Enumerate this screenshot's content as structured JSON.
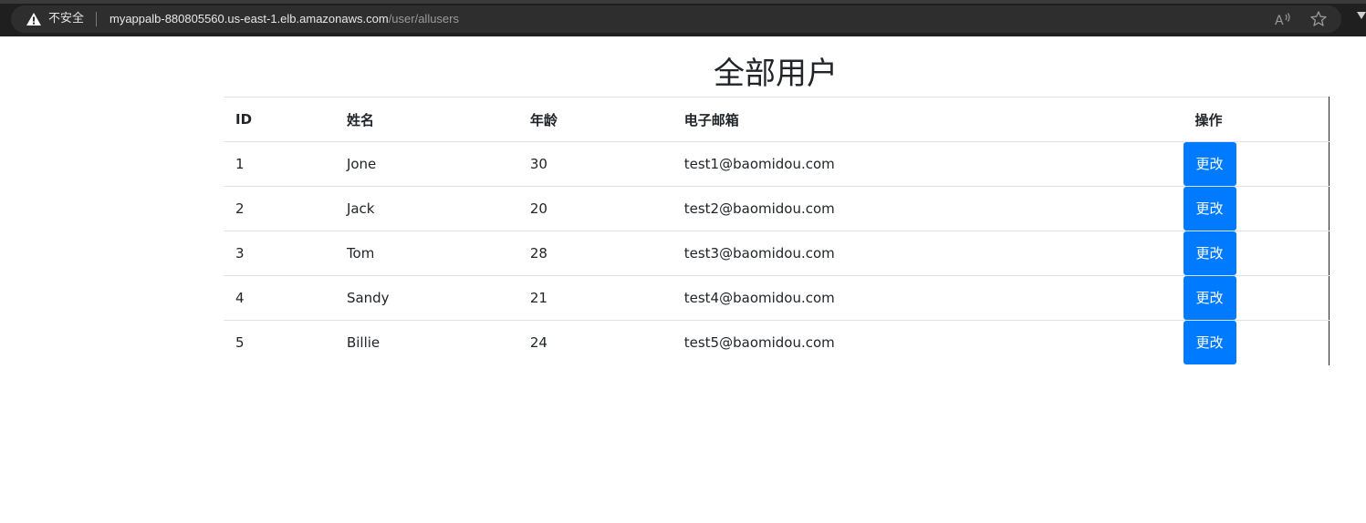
{
  "browser": {
    "insecure_label": "不安全",
    "url_host": "myappalb-880805560.us-east-1.elb.amazonaws.com",
    "url_path": "/user/allusers"
  },
  "page": {
    "title": "全部用户"
  },
  "table": {
    "headers": {
      "id": "ID",
      "name": "姓名",
      "age": "年龄",
      "email": "电子邮箱",
      "operation": "操作"
    },
    "rows": [
      {
        "id": "1",
        "name": "Jone",
        "age": "30",
        "email": "test1@baomidou.com",
        "action": "更改"
      },
      {
        "id": "2",
        "name": "Jack",
        "age": "20",
        "email": "test2@baomidou.com",
        "action": "更改"
      },
      {
        "id": "3",
        "name": "Tom",
        "age": "28",
        "email": "test3@baomidou.com",
        "action": "更改"
      },
      {
        "id": "4",
        "name": "Sandy",
        "age": "21",
        "email": "test4@baomidou.com",
        "action": "更改"
      },
      {
        "id": "5",
        "name": "Billie",
        "age": "24",
        "email": "test5@baomidou.com",
        "action": "更改"
      }
    ]
  },
  "colors": {
    "button": "#007bff",
    "text": "#212529",
    "border": "#dee2e6"
  },
  "icons": {
    "warning": "warning-triangle-icon",
    "read_aloud": "read-aloud-icon",
    "favorite": "star-icon"
  }
}
